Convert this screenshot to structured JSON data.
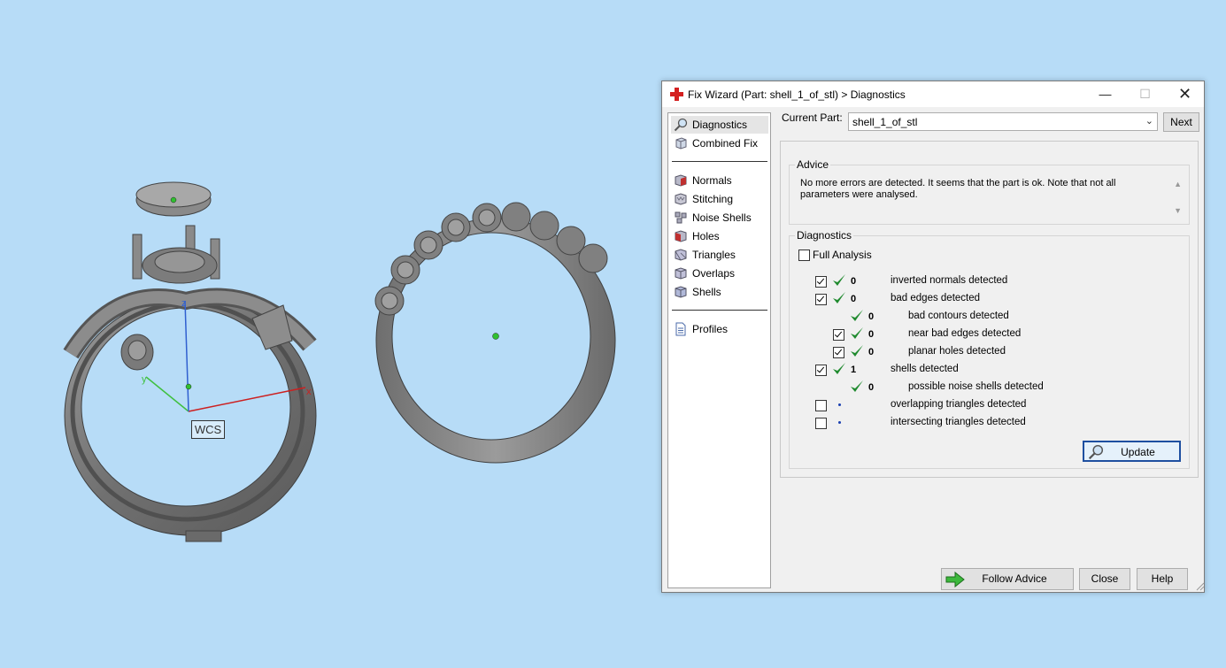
{
  "viewport": {
    "wcs_label": "WCS",
    "axis_x": "x",
    "axis_y": "y",
    "axis_z": "z"
  },
  "dialog": {
    "title": "Fix Wizard (Part: shell_1_of_stl) > Diagnostics",
    "nav": {
      "top_items": [
        {
          "label": "Diagnostics",
          "icon": "magnifier-icon",
          "selected": true
        },
        {
          "label": "Combined Fix",
          "icon": "cube-icon"
        }
      ],
      "fix_items": [
        {
          "label": "Normals",
          "icon": "normals-cube-icon"
        },
        {
          "label": "Stitching",
          "icon": "stitching-cube-icon"
        },
        {
          "label": "Noise Shells",
          "icon": "noise-shells-icon"
        },
        {
          "label": "Holes",
          "icon": "holes-cube-icon"
        },
        {
          "label": "Triangles",
          "icon": "triangles-cube-icon"
        },
        {
          "label": "Overlaps",
          "icon": "overlaps-cube-icon"
        },
        {
          "label": "Shells",
          "icon": "shells-cube-icon"
        }
      ],
      "profiles": {
        "label": "Profiles",
        "icon": "document-icon"
      }
    },
    "current_part_label": "Current Part:",
    "current_part_value": "shell_1_of_stl",
    "next_label": "Next",
    "advice": {
      "title": "Advice",
      "text": "No more errors are detected. It seems that the part is ok. Note that not all parameters were analysed."
    },
    "diagnostics": {
      "title": "Diagnostics",
      "full_analysis_label": "Full Analysis",
      "full_analysis_checked": false,
      "rows": [
        {
          "checkbox": true,
          "checked": true,
          "status": "ok",
          "count": "0",
          "label": "inverted normals detected",
          "indent": 0
        },
        {
          "checkbox": true,
          "checked": true,
          "status": "ok",
          "count": "0",
          "label": "bad edges detected",
          "indent": 0
        },
        {
          "checkbox": false,
          "checked": false,
          "status": "ok",
          "count": "0",
          "label": "bad contours detected",
          "indent": 1
        },
        {
          "checkbox": true,
          "checked": true,
          "status": "ok",
          "count": "0",
          "label": "near bad edges detected",
          "indent": 1
        },
        {
          "checkbox": true,
          "checked": true,
          "status": "ok",
          "count": "0",
          "label": "planar holes detected",
          "indent": 1
        },
        {
          "checkbox": true,
          "checked": true,
          "status": "ok",
          "count": "1",
          "label": "shells detected",
          "indent": 0
        },
        {
          "checkbox": false,
          "checked": false,
          "status": "ok",
          "count": "0",
          "label": "possible noise shells detected",
          "indent": 1
        },
        {
          "checkbox": true,
          "checked": false,
          "status": "none",
          "count": "",
          "label": "overlapping triangles detected",
          "indent": 0
        },
        {
          "checkbox": true,
          "checked": false,
          "status": "none",
          "count": "",
          "label": "intersecting triangles detected",
          "indent": 0
        }
      ],
      "update_label": "Update"
    },
    "buttons": {
      "follow_advice": "Follow Advice",
      "close": "Close",
      "help": "Help"
    }
  },
  "colors": {
    "viewport_bg": "#b7dcf7",
    "check_green": "#1f8a2e",
    "dot_blue": "#1a3fb0",
    "update_border": "#1e4fa0"
  }
}
